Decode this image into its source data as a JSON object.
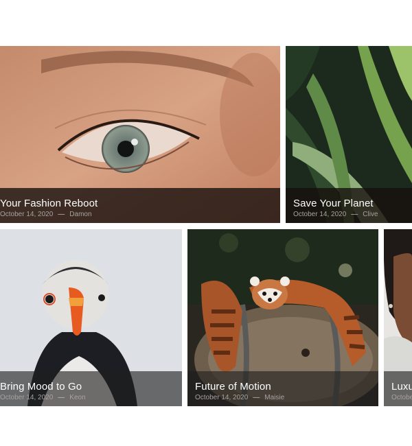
{
  "posts": [
    {
      "title": "Your Fashion Reboot",
      "date": "October 14, 2020",
      "separator": "—",
      "author": "Damon",
      "image": "eye-closeup-photo"
    },
    {
      "title": "Save Your Planet",
      "date": "October 14, 2020",
      "separator": "—",
      "author": "Clive",
      "image": "green-leaves-photo"
    },
    {
      "title": "Bring Mood to Go",
      "date": "October 14, 2020",
      "separator": "—",
      "author": "Keon",
      "image": "puffin-photo"
    },
    {
      "title": "Future of Motion",
      "date": "October 14, 2020",
      "separator": "—",
      "author": "Maisie",
      "image": "red-panda-barrel-photo"
    },
    {
      "title": "Luxu",
      "date": "Octobe",
      "author": "",
      "image": "woman-portrait-photo"
    }
  ]
}
